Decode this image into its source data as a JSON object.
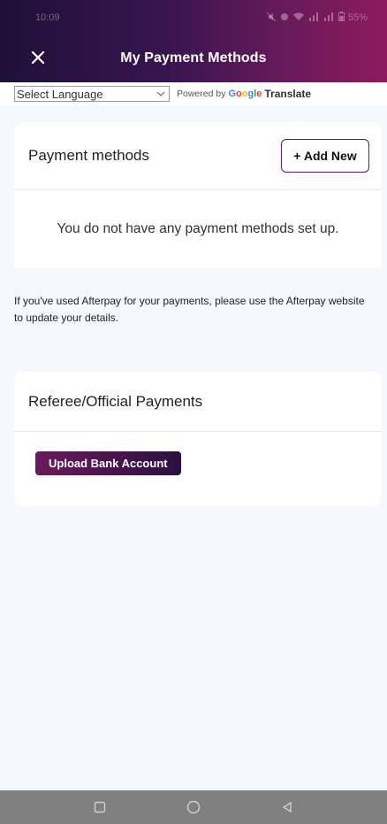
{
  "status_bar": {
    "time": "10:09",
    "battery": "55%"
  },
  "header": {
    "title": "My Payment Methods",
    "close_icon": "close-icon"
  },
  "translate": {
    "selected_language": "Select Language",
    "powered_by": "Powered by",
    "google": [
      "G",
      "o",
      "o",
      "g",
      "l",
      "e"
    ],
    "translate_label": "Translate"
  },
  "payment_methods": {
    "title": "Payment methods",
    "add_new_label": "+ Add New",
    "empty_message": "You do not have any payment methods set up.",
    "afterpay_note": "If you've used Afterpay for your payments, please use the Afterpay website to update your details."
  },
  "referee_payments": {
    "title": "Referee/Official Payments",
    "upload_label": "Upload Bank Account"
  },
  "colors": {
    "header_start": "#1e1038",
    "header_end": "#8e1a5e",
    "accent": "#6a1a5a",
    "nav_bar": "#808080"
  }
}
